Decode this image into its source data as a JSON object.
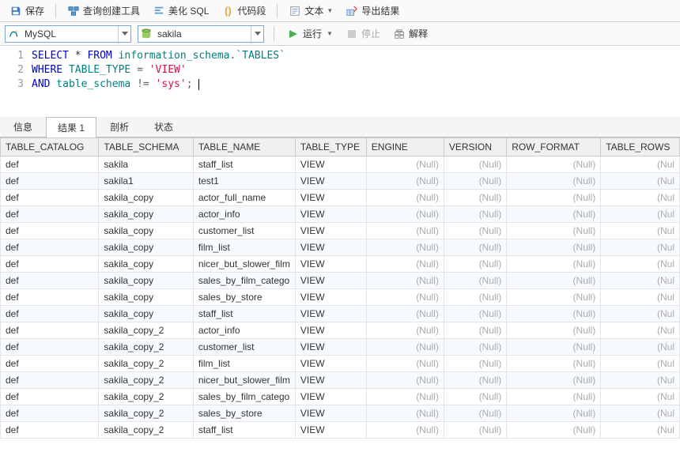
{
  "toolbar": {
    "save": "保存",
    "query_builder": "查询创建工具",
    "beautify_sql": "美化 SQL",
    "snippets": "代码段",
    "text": "文本",
    "export": "导出结果"
  },
  "row2": {
    "conn": {
      "icon": "mysql",
      "label": "MySQL"
    },
    "db": {
      "icon": "db",
      "label": "sakila"
    },
    "run": "运行",
    "stop": "停止",
    "explain": "解释"
  },
  "code": {
    "lines": [
      "1",
      "2",
      "3"
    ],
    "tokens": [
      [
        "SELECT",
        " * ",
        "FROM",
        " ",
        "information_schema",
        ".",
        "`TABLES`"
      ],
      [
        "WHERE",
        " TABLE_TYPE ",
        "=",
        " ",
        "'VIEW'"
      ],
      [
        "AND",
        " table_schema ",
        "!=",
        " ",
        "'sys'",
        ";",
        " "
      ]
    ]
  },
  "tabs": {
    "info": "信息",
    "result": "结果 1",
    "profile": "剖析",
    "status": "状态",
    "active": 1
  },
  "grid": {
    "columns": [
      "TABLE_CATALOG",
      "TABLE_SCHEMA",
      "TABLE_NAME",
      "TABLE_TYPE",
      "ENGINE",
      "VERSION",
      "ROW_FORMAT",
      "TABLE_ROWS"
    ],
    "null_text": "(Null)",
    "null_trunc": "(Nul",
    "rows": [
      [
        "def",
        "sakila",
        "staff_list",
        "VIEW",
        null,
        null,
        null,
        null
      ],
      [
        "def",
        "sakila1",
        "test1",
        "VIEW",
        null,
        null,
        null,
        null
      ],
      [
        "def",
        "sakila_copy",
        "actor_full_name",
        "VIEW",
        null,
        null,
        null,
        null
      ],
      [
        "def",
        "sakila_copy",
        "actor_info",
        "VIEW",
        null,
        null,
        null,
        null
      ],
      [
        "def",
        "sakila_copy",
        "customer_list",
        "VIEW",
        null,
        null,
        null,
        null
      ],
      [
        "def",
        "sakila_copy",
        "film_list",
        "VIEW",
        null,
        null,
        null,
        null
      ],
      [
        "def",
        "sakila_copy",
        "nicer_but_slower_film",
        "VIEW",
        null,
        null,
        null,
        null
      ],
      [
        "def",
        "sakila_copy",
        "sales_by_film_catego",
        "VIEW",
        null,
        null,
        null,
        null
      ],
      [
        "def",
        "sakila_copy",
        "sales_by_store",
        "VIEW",
        null,
        null,
        null,
        null
      ],
      [
        "def",
        "sakila_copy",
        "staff_list",
        "VIEW",
        null,
        null,
        null,
        null
      ],
      [
        "def",
        "sakila_copy_2",
        "actor_info",
        "VIEW",
        null,
        null,
        null,
        null
      ],
      [
        "def",
        "sakila_copy_2",
        "customer_list",
        "VIEW",
        null,
        null,
        null,
        null
      ],
      [
        "def",
        "sakila_copy_2",
        "film_list",
        "VIEW",
        null,
        null,
        null,
        null
      ],
      [
        "def",
        "sakila_copy_2",
        "nicer_but_slower_film",
        "VIEW",
        null,
        null,
        null,
        null
      ],
      [
        "def",
        "sakila_copy_2",
        "sales_by_film_catego",
        "VIEW",
        null,
        null,
        null,
        null
      ],
      [
        "def",
        "sakila_copy_2",
        "sales_by_store",
        "VIEW",
        null,
        null,
        null,
        null
      ],
      [
        "def",
        "sakila_copy_2",
        "staff_list",
        "VIEW",
        null,
        null,
        null,
        null
      ]
    ]
  }
}
